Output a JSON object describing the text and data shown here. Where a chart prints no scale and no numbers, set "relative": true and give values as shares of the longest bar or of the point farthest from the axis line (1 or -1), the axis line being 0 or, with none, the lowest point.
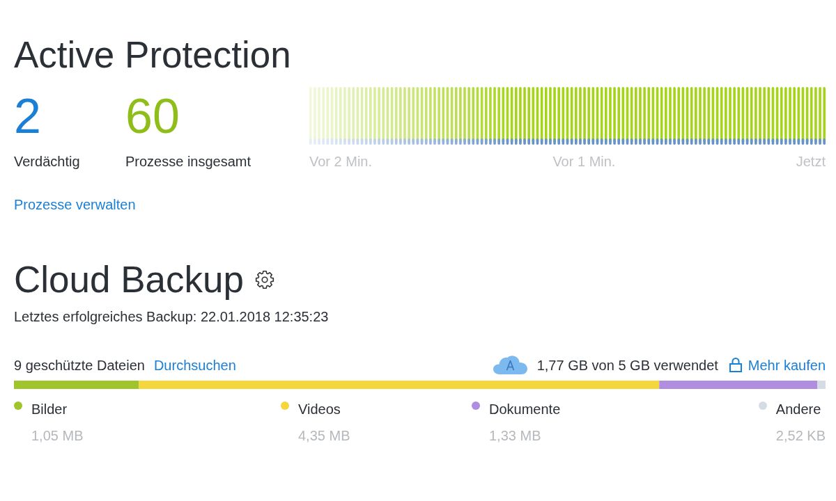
{
  "active_protection": {
    "title": "Active Protection",
    "stats": [
      {
        "value": "2",
        "label": "Verdächtig",
        "color": "#1b7fd6"
      },
      {
        "value": "60",
        "label": "Prozesse insgesamt",
        "color": "#8fbd1a"
      }
    ],
    "activity_graph": {
      "labels": [
        "Vor 2 Min.",
        "Vor 1 Min.",
        "Jetzt"
      ]
    },
    "manage_link": "Prozesse verwalten"
  },
  "cloud_backup": {
    "title": "Cloud Backup",
    "last_backup": "Letztes erfolgreiches Backup: 22.01.2018 12:35:23",
    "protected_files": "9 geschützte Dateien",
    "browse_link": "Durchsuchen",
    "usage": "1,77 GB von 5 GB verwendet",
    "buy_link": "Mehr kaufen",
    "usage_chart": {
      "chart_data": {
        "type": "bar",
        "orientation": "horizontal",
        "stacked": true,
        "relative": true,
        "legend": "bottom",
        "series": [
          {
            "name": "Bilder",
            "color": "#9fc42c",
            "values": [
              0.154
            ]
          },
          {
            "name": "Videos",
            "color": "#f5d63d",
            "values": [
              0.641
            ]
          },
          {
            "name": "Dokumente",
            "color": "#b18de0",
            "values": [
              0.195
            ]
          },
          {
            "name": "Andere",
            "color": "#d6dbe6",
            "values": [
              0.01
            ]
          }
        ]
      },
      "sizes": [
        "1,05 MB",
        "4,35 MB",
        "1,33 MB",
        "2,52 KB"
      ]
    }
  }
}
